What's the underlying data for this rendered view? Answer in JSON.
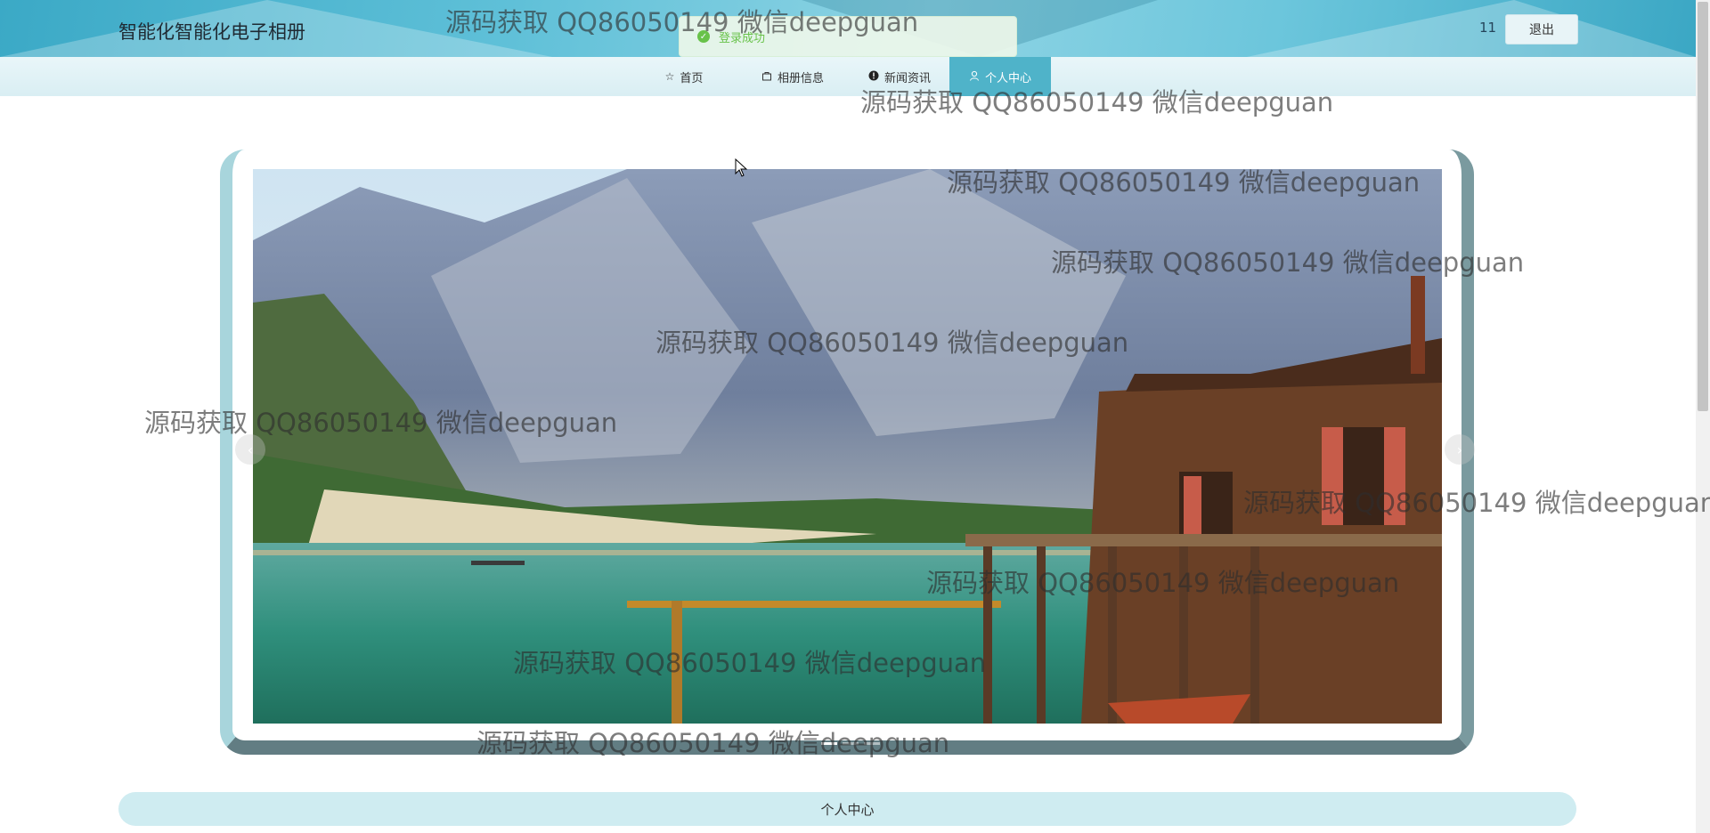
{
  "header": {
    "title": "智能化智能化电子相册",
    "username": "11",
    "logout_label": "退出"
  },
  "toast": {
    "message": "登录成功",
    "icon": "check-circle-icon"
  },
  "nav": {
    "items": [
      {
        "label": "首页",
        "icon": "star-icon"
      },
      {
        "label": "相册信息",
        "icon": "bag-icon"
      },
      {
        "label": "新闻资讯",
        "icon": "info-icon"
      },
      {
        "label": "个人中心",
        "icon": "user-icon",
        "active": true
      }
    ]
  },
  "carousel": {
    "slide_count": 3,
    "active_index": 0,
    "prev_icon": "chevron-left-icon",
    "next_icon": "chevron-right-icon"
  },
  "section": {
    "title": "个人中心"
  },
  "watermark": {
    "text": "源码获取 QQ86050149 微信deepguan"
  }
}
